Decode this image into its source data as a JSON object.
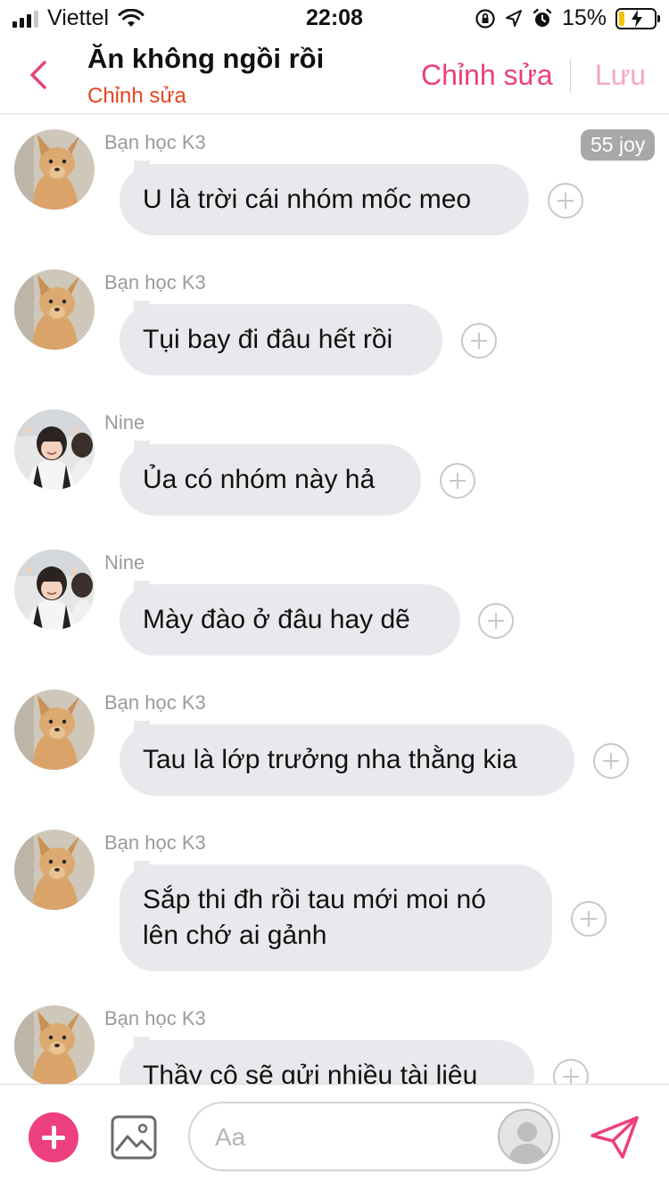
{
  "status_bar": {
    "carrier": "Viettel",
    "time": "22:08",
    "battery_percent": "15%",
    "battery_level": 0.15,
    "icons": [
      "signal-icon",
      "wifi-icon",
      "orientation-lock-icon",
      "location-icon",
      "alarm-icon",
      "battery-icon"
    ]
  },
  "header": {
    "title": "Ăn không ngồi rồi",
    "subtitle": "Chỉnh sửa",
    "edit_label": "Chỉnh sửa",
    "save_label": "Lưu",
    "colors": {
      "accent": "#e9417d",
      "subtitle": "#e8441f",
      "save_disabled": "#f4a8c3"
    }
  },
  "messages": [
    {
      "sender": "Bạn học K3",
      "avatar": "dog",
      "text": "U là trời cái nhóm mốc meo",
      "badge": "55 joy"
    },
    {
      "sender": "Bạn học K3",
      "avatar": "dog",
      "text": "Tụi bay đi đâu hết rồi"
    },
    {
      "sender": "Nine",
      "avatar": "girl",
      "text": "Ủa có nhóm này hả"
    },
    {
      "sender": "Nine",
      "avatar": "girl",
      "text": "Mày đào ở đâu hay dẽ"
    },
    {
      "sender": "Bạn học K3",
      "avatar": "dog",
      "text": "Tau là lớp trưởng nha thằng kia"
    },
    {
      "sender": "Bạn học K3",
      "avatar": "dog",
      "text": "Sắp thi đh rồi tau mới moi nó lên chớ ai gảnh"
    },
    {
      "sender": "Bạn học K3",
      "avatar": "dog",
      "text": "Thầy cô sẽ gửi nhiều tài liệu"
    }
  ],
  "composer": {
    "placeholder": "Aa",
    "colors": {
      "plus_button": "#ee3f7e",
      "send_icon": "#ee3f7e"
    }
  }
}
